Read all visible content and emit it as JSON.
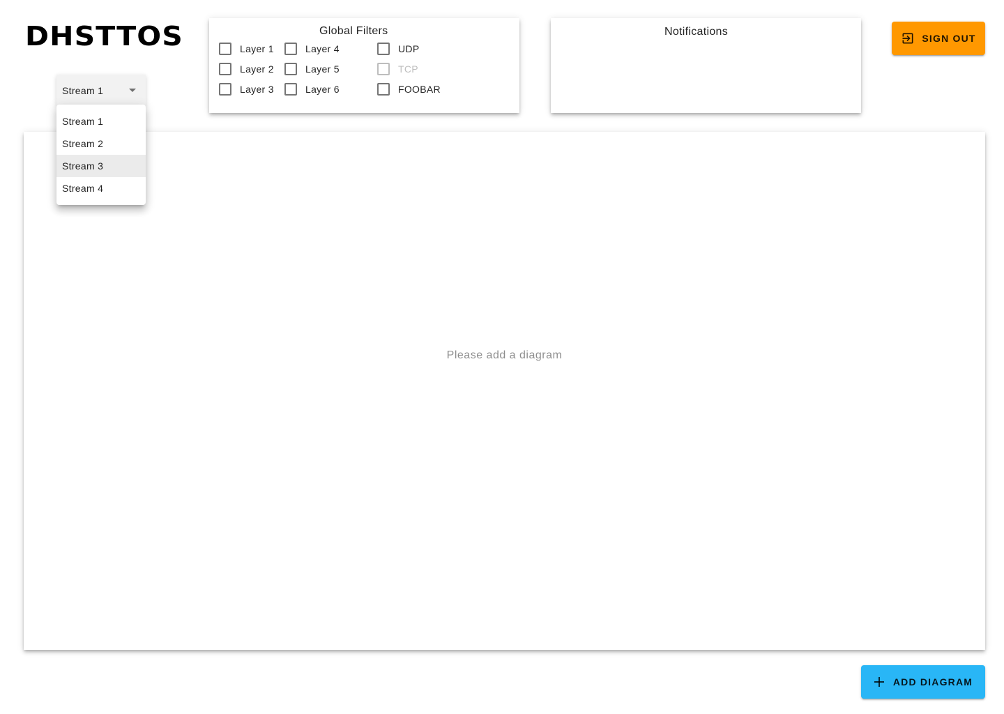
{
  "app": {
    "logo": "DHSTTOS"
  },
  "filters": {
    "title": "Global Filters",
    "items": [
      {
        "label": "Layer 1",
        "checked": false,
        "disabled": false
      },
      {
        "label": "Layer 2",
        "checked": false,
        "disabled": false
      },
      {
        "label": "Layer 3",
        "checked": false,
        "disabled": false
      },
      {
        "label": "Layer 4",
        "checked": false,
        "disabled": false
      },
      {
        "label": "Layer 5",
        "checked": false,
        "disabled": false
      },
      {
        "label": "Layer 6",
        "checked": false,
        "disabled": false
      },
      {
        "label": "UDP",
        "checked": false,
        "disabled": false
      },
      {
        "label": "TCP",
        "checked": false,
        "disabled": true
      },
      {
        "label": "FOOBAR",
        "checked": false,
        "disabled": false
      }
    ]
  },
  "notifications": {
    "title": "Notifications"
  },
  "signout": {
    "label": "SIGN OUT",
    "icon": "exit-icon",
    "color": "#ff9800"
  },
  "stream_select": {
    "value": "Stream 1",
    "options": [
      "Stream 1",
      "Stream 2",
      "Stream 3",
      "Stream 4"
    ],
    "highlighted": "Stream 3"
  },
  "main": {
    "empty_message": "Please add a diagram"
  },
  "add_diagram": {
    "label": "ADD DIAGRAM",
    "icon": "plus-icon",
    "color": "#29b6f6"
  }
}
